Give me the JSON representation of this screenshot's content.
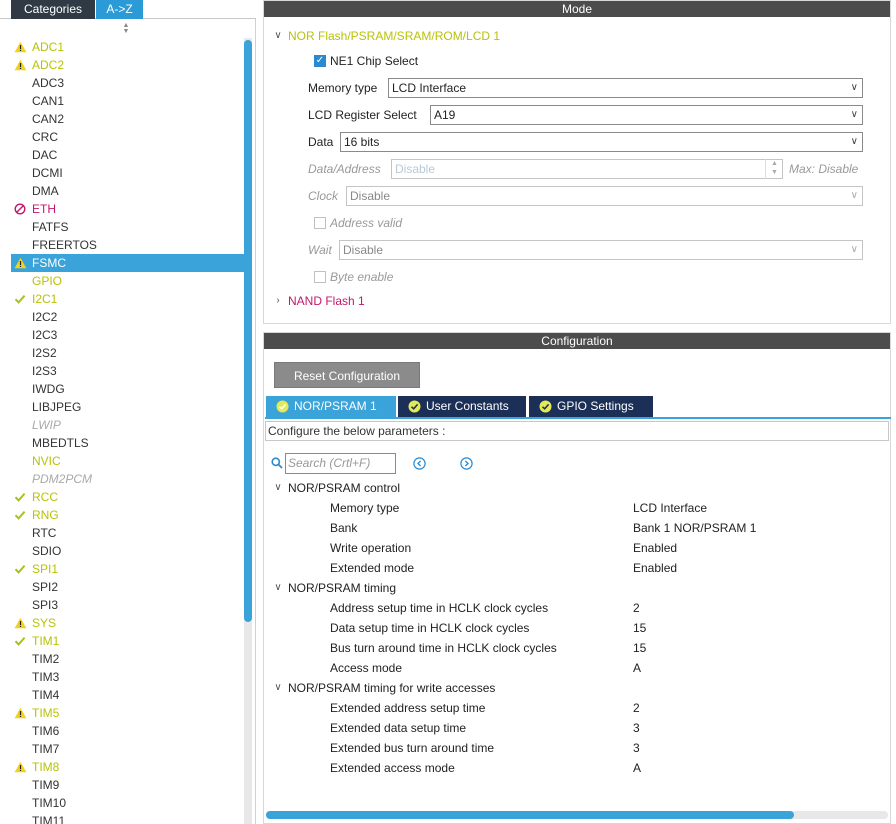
{
  "left_panel": {
    "tabs": {
      "categories": "Categories",
      "az": "A->Z"
    },
    "items": [
      {
        "label": "ADC1",
        "state": "warn"
      },
      {
        "label": "ADC2",
        "state": "warn"
      },
      {
        "label": "ADC3",
        "state": "none"
      },
      {
        "label": "CAN1",
        "state": "none"
      },
      {
        "label": "CAN2",
        "state": "none"
      },
      {
        "label": "CRC",
        "state": "none"
      },
      {
        "label": "DAC",
        "state": "none"
      },
      {
        "label": "DCMI",
        "state": "none"
      },
      {
        "label": "DMA",
        "state": "none"
      },
      {
        "label": "ETH",
        "state": "ban"
      },
      {
        "label": "FATFS",
        "state": "none"
      },
      {
        "label": "FREERTOS",
        "state": "none"
      },
      {
        "label": "FSMC",
        "state": "warn-selected"
      },
      {
        "label": "GPIO",
        "state": "enabled"
      },
      {
        "label": "I2C1",
        "state": "ok"
      },
      {
        "label": "I2C2",
        "state": "none"
      },
      {
        "label": "I2C3",
        "state": "none"
      },
      {
        "label": "I2S2",
        "state": "none"
      },
      {
        "label": "I2S3",
        "state": "none"
      },
      {
        "label": "IWDG",
        "state": "none"
      },
      {
        "label": "LIBJPEG",
        "state": "none"
      },
      {
        "label": "LWIP",
        "state": "disabled"
      },
      {
        "label": "MBEDTLS",
        "state": "none"
      },
      {
        "label": "NVIC",
        "state": "enabled"
      },
      {
        "label": "PDM2PCM",
        "state": "disabled"
      },
      {
        "label": "RCC",
        "state": "ok"
      },
      {
        "label": "RNG",
        "state": "ok"
      },
      {
        "label": "RTC",
        "state": "none"
      },
      {
        "label": "SDIO",
        "state": "none"
      },
      {
        "label": "SPI1",
        "state": "ok"
      },
      {
        "label": "SPI2",
        "state": "none"
      },
      {
        "label": "SPI3",
        "state": "none"
      },
      {
        "label": "SYS",
        "state": "warn"
      },
      {
        "label": "TIM1",
        "state": "ok"
      },
      {
        "label": "TIM2",
        "state": "none"
      },
      {
        "label": "TIM3",
        "state": "none"
      },
      {
        "label": "TIM4",
        "state": "none"
      },
      {
        "label": "TIM5",
        "state": "warn"
      },
      {
        "label": "TIM6",
        "state": "none"
      },
      {
        "label": "TIM7",
        "state": "none"
      },
      {
        "label": "TIM8",
        "state": "warn"
      },
      {
        "label": "TIM9",
        "state": "none"
      },
      {
        "label": "TIM10",
        "state": "none"
      },
      {
        "label": "TIM11",
        "state": "none"
      }
    ]
  },
  "mode_panel": {
    "title": "Mode",
    "nor_header": "NOR Flash/PSRAM/SRAM/ROM/LCD 1",
    "ne1_label": "NE1 Chip Select",
    "memory_type": {
      "label": "Memory type",
      "value": "LCD Interface"
    },
    "lcd_register_select": {
      "label": "LCD Register Select",
      "value": "A19"
    },
    "data": {
      "label": "Data",
      "value": "16 bits"
    },
    "data_address": {
      "label": "Data/Address",
      "value": "Disable",
      "max_label": "Max: Disable"
    },
    "clock": {
      "label": "Clock",
      "value": "Disable"
    },
    "address_valid_label": "Address valid",
    "wait": {
      "label": "Wait",
      "value": "Disable"
    },
    "byte_enable_label": "Byte enable",
    "nand_header": "NAND Flash 1"
  },
  "config_panel": {
    "title": "Configuration",
    "reset_button": "Reset Configuration",
    "tabs": {
      "nor": "NOR/PSRAM 1",
      "user_constants": "User Constants",
      "gpio": "GPIO Settings"
    },
    "description": "Configure the below parameters :",
    "search_placeholder": "Search (Crtl+F)",
    "groups": [
      {
        "title": "NOR/PSRAM control",
        "params": [
          {
            "name": "Memory type",
            "value": "LCD Interface"
          },
          {
            "name": "Bank",
            "value": "Bank 1 NOR/PSRAM 1"
          },
          {
            "name": "Write operation",
            "value": "Enabled"
          },
          {
            "name": "Extended mode",
            "value": "Enabled"
          }
        ]
      },
      {
        "title": "NOR/PSRAM timing",
        "params": [
          {
            "name": "Address setup time in HCLK clock cycles",
            "value": "2"
          },
          {
            "name": "Data setup time in HCLK clock cycles",
            "value": "15"
          },
          {
            "name": "Bus turn around time in HCLK clock cycles",
            "value": "15"
          },
          {
            "name": "Access mode",
            "value": "A"
          }
        ]
      },
      {
        "title": "NOR/PSRAM timing for write accesses",
        "params": [
          {
            "name": "Extended address setup time",
            "value": "2"
          },
          {
            "name": "Extended data setup time",
            "value": "3"
          },
          {
            "name": "Extended bus turn around time",
            "value": "3"
          },
          {
            "name": "Extended access mode",
            "value": "A"
          }
        ]
      }
    ]
  }
}
